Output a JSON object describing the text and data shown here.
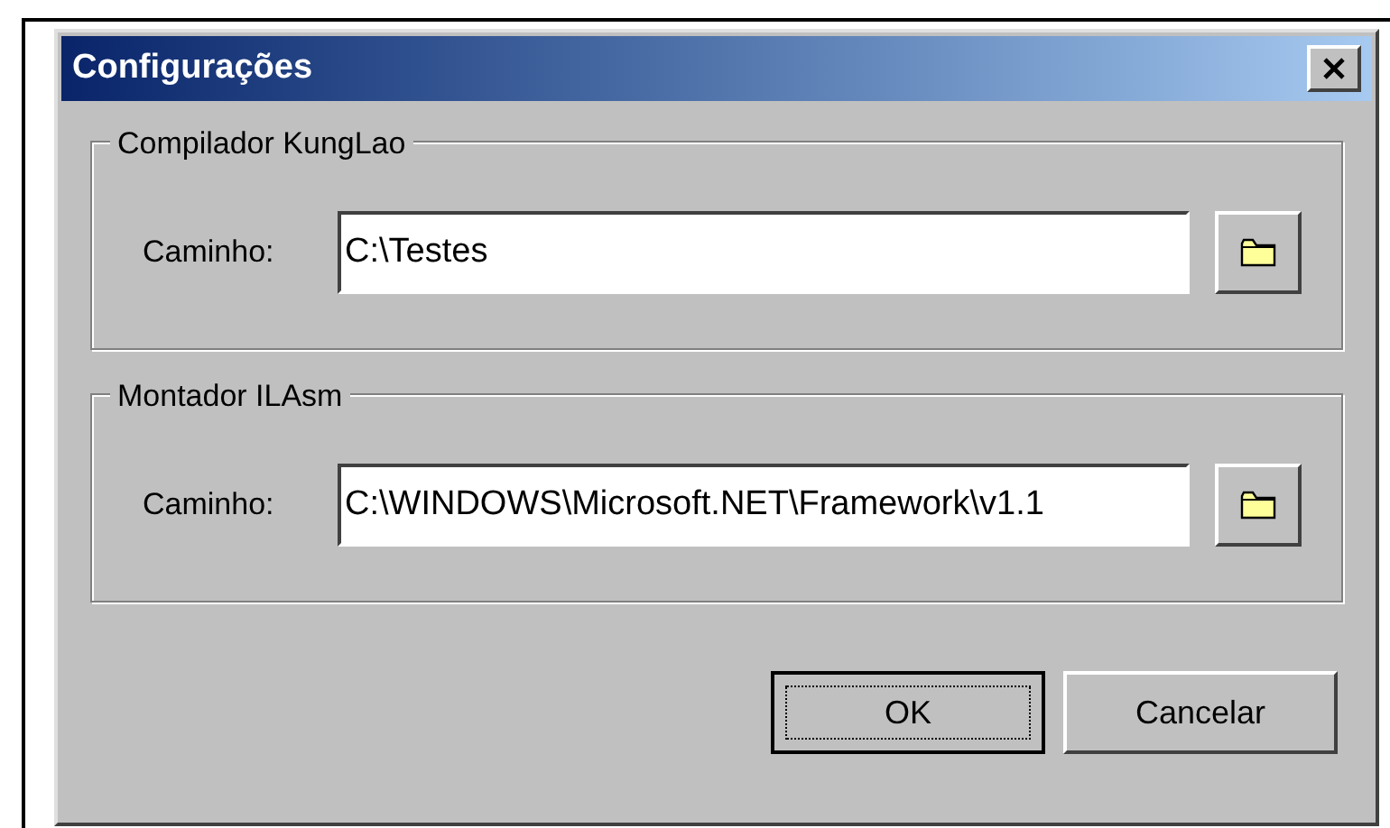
{
  "window": {
    "title": "Configurações"
  },
  "groups": [
    {
      "title": "Compilador KungLao",
      "label": "Caminho:",
      "value": "C:\\Testes"
    },
    {
      "title": "Montador ILAsm",
      "label": "Caminho:",
      "value": "C:\\WINDOWS\\Microsoft.NET\\Framework\\v1.1"
    }
  ],
  "buttons": [
    {
      "label": "OK",
      "default": true
    },
    {
      "label": "Cancelar",
      "default": false
    }
  ]
}
